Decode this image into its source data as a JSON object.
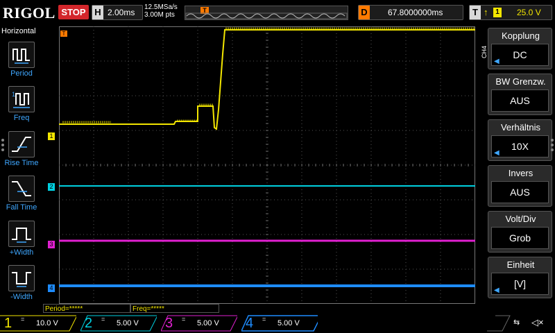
{
  "brand": {
    "logo": "RIGOL",
    "run_state": "STOP"
  },
  "horizontal": {
    "letter": "H",
    "timebase": "2.00ms",
    "sample_rate": "12.5MSa/s",
    "memory_depth": "3.00M pts"
  },
  "trigger_position": {
    "letter": "T"
  },
  "delay": {
    "letter": "D",
    "value": "67.8000000ms"
  },
  "trigger": {
    "letter": "T",
    "source": "1",
    "level": "25.0 V"
  },
  "left_panel": {
    "title": "Horizontal",
    "items": [
      {
        "label": "Period",
        "icon": "period-icon"
      },
      {
        "label": "Freq",
        "icon": "freq-icon"
      },
      {
        "label": "Rise Time",
        "icon": "rise-time-icon"
      },
      {
        "label": "Fall Time",
        "icon": "fall-time-icon"
      },
      {
        "label": "+Width",
        "icon": "positive-width-icon"
      },
      {
        "label": "-Width",
        "icon": "negative-width-icon"
      }
    ]
  },
  "right_panel": {
    "channel_label": "CH4",
    "cards": [
      {
        "title": "Kopplung",
        "value": "DC",
        "arrow": true
      },
      {
        "title": "BW Grenzw.",
        "value": "AUS",
        "arrow": false
      },
      {
        "title": "Verhältnis",
        "value": "10X",
        "arrow": true
      },
      {
        "title": "Invers",
        "value": "AUS",
        "arrow": false
      },
      {
        "title": "Volt/Div",
        "value": "Grob",
        "arrow": false
      },
      {
        "title": "Einheit",
        "value": "[V]",
        "arrow": true
      }
    ]
  },
  "waveform_markers": [
    {
      "id": "1",
      "color": "#f3e600"
    },
    {
      "id": "2",
      "color": "#00d0e0"
    },
    {
      "id": "3",
      "color": "#e020d0"
    },
    {
      "id": "4",
      "color": "#1e8cff"
    }
  ],
  "measurements": [
    {
      "label": "Period=*****"
    },
    {
      "label": "Freq=*****"
    }
  ],
  "channels": [
    {
      "num": "1",
      "coupling": "=",
      "scale": "10.0 V",
      "color": "#f3e600"
    },
    {
      "num": "2",
      "coupling": "=",
      "scale": "5.00 V",
      "color": "#00d0e0"
    },
    {
      "num": "3",
      "coupling": "=",
      "scale": "5.00 V",
      "color": "#e020d0"
    },
    {
      "num": "4",
      "coupling": "=",
      "scale": "5.00 V",
      "color": "#1e8cff"
    }
  ],
  "status_icons": {
    "usb": "usb-icon",
    "speaker": "speaker-muted-icon"
  }
}
